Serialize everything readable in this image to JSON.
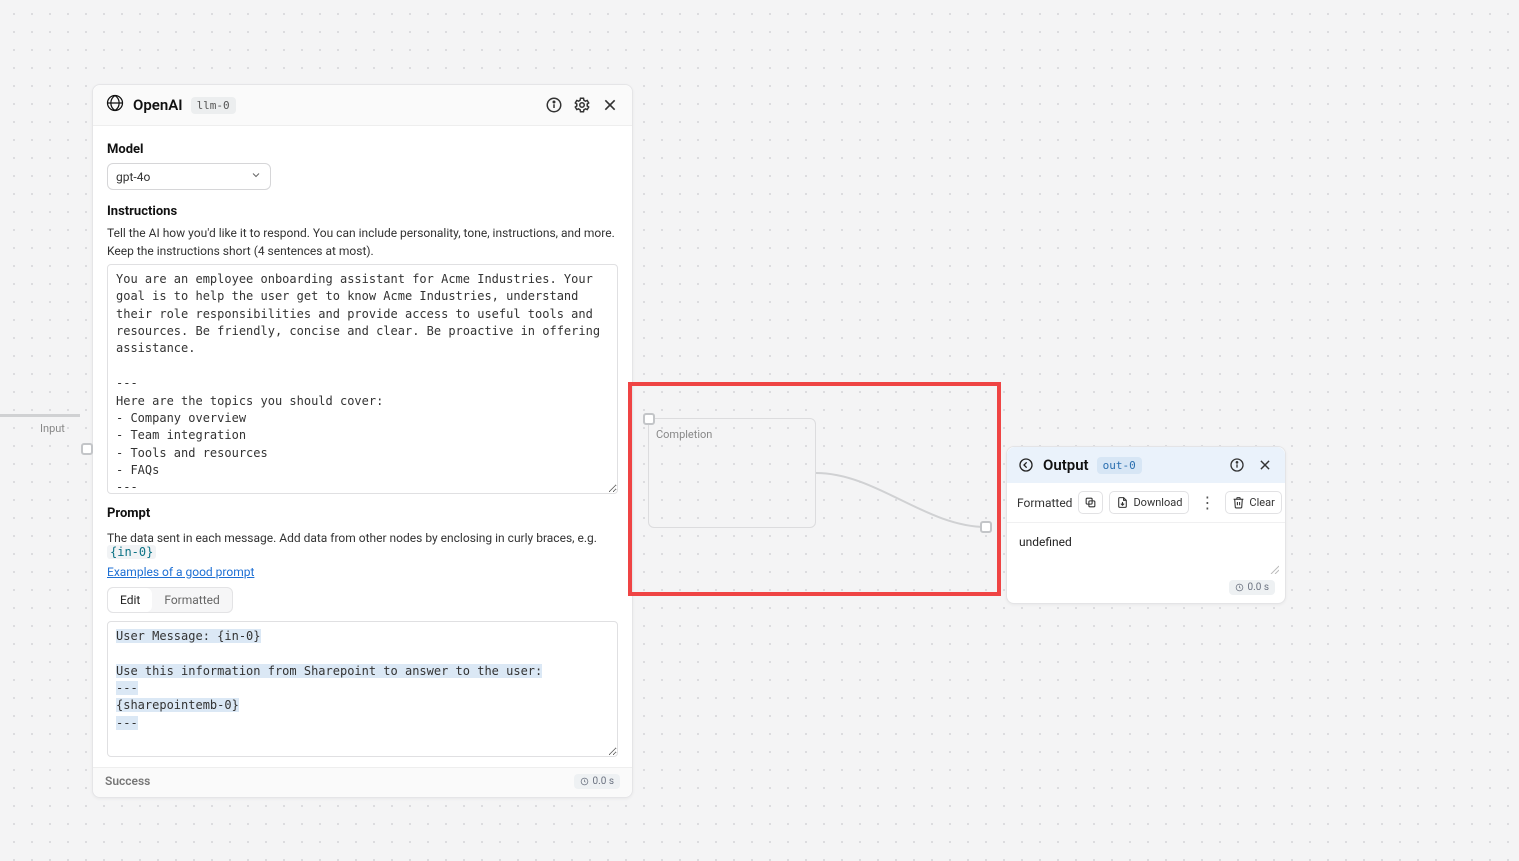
{
  "llm": {
    "title": "OpenAI",
    "tag": "llm-0",
    "model_label": "Model",
    "model_value": "gpt-4o",
    "instructions_label": "Instructions",
    "instructions_desc1": "Tell the AI how you'd like it to respond. You can include personality, tone, instructions, and more.",
    "instructions_desc2": "Keep the instructions short (4 sentences at most).",
    "instructions_value": "You are an employee onboarding assistant for Acme Industries. Your goal is to help the user get to know Acme Industries, understand their role responsibilities and provide access to useful tools and resources. Be friendly, concise and clear. Be proactive in offering assistance.\n\n---\nHere are the topics you should cover:\n- Company overview\n- Team integration\n- Tools and resources\n- FAQs\n---\n\nIf the user asks something outside your knowledge base, kindly state that you can't help them with that information and that they should speak to their point of contact to know more.",
    "prompt_label": "Prompt",
    "prompt_desc_prefix": "The data sent in each message. Add data from other nodes by enclosing in curly braces, e.g. ",
    "prompt_desc_token": "{in-0}",
    "prompt_link": "Examples of a good prompt",
    "tab_edit": "Edit",
    "tab_formatted": "Formatted",
    "prompt_parts": {
      "p1": "User Message: ",
      "t1": "{in-0}",
      "p2": "\n\nUse this information from Sharepoint to answer to the user:",
      "p3": "\n---\n",
      "t2": "{sharepointemb-0}",
      "p4": "\n---"
    },
    "status": "Success",
    "time": "0.0 s"
  },
  "edge_input_label": "Input",
  "completion_label": "Completion",
  "output": {
    "title": "Output",
    "tag": "out-0",
    "formatted_label": "Formatted",
    "download_label": "Download",
    "clear_label": "Clear",
    "value": "undefined",
    "time": "0.0 s"
  }
}
